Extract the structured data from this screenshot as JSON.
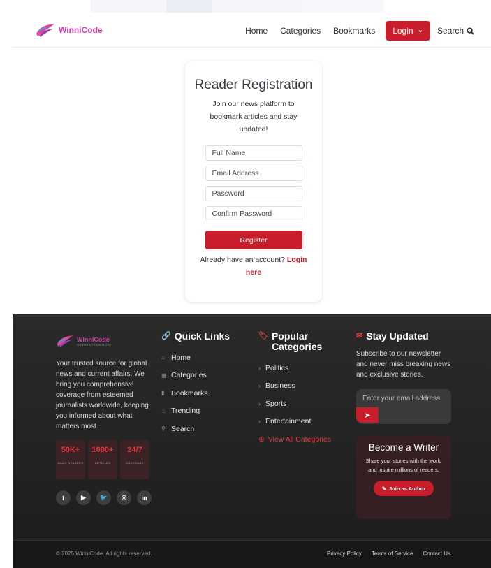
{
  "navbar": {
    "brand": "WinniCode",
    "links": [
      "Home",
      "Categories",
      "Bookmarks"
    ],
    "login_label": "Login",
    "search_label": "Search"
  },
  "registration": {
    "title": "Reader Registration",
    "subtitle": "Join our news platform to bookmark articles and stay updated!",
    "full_name_placeholder": "Full Name",
    "email_placeholder": "Email Address",
    "password_placeholder": "Password",
    "confirm_password_placeholder": "Confirm Password",
    "register_label": "Register",
    "have_account_text": "Already have an account?",
    "login_link": "Login here"
  },
  "footer": {
    "brand": "WinniCode",
    "brand_sub": "GARUDA TEKNOLOGI",
    "about": "Your trusted source for global news and current affairs. We bring you comprehensive coverage from esteemed journalists worldwide, keeping you informed about what matters most.",
    "stats": [
      {
        "value": "50K+",
        "label": "DAILY READERS"
      },
      {
        "value": "1000+",
        "label": "ARTICLES"
      },
      {
        "value": "24/7",
        "label": "COVERAGE"
      }
    ],
    "socials": [
      "f",
      "▶",
      "🐦",
      "◎",
      "in"
    ],
    "quick_links_title": "Quick Links",
    "quick_links": [
      {
        "label": "Home",
        "icon": "⌂"
      },
      {
        "label": "Categories",
        "icon": "▦"
      },
      {
        "label": "Bookmarks",
        "icon": "▮"
      },
      {
        "label": "Trending",
        "icon": "♨"
      },
      {
        "label": "Search",
        "icon": "⚲"
      }
    ],
    "popular_title": "Popular Categories",
    "categories": [
      "Politics",
      "Business",
      "Sports",
      "Entertainment"
    ],
    "view_all": "View All Categories",
    "stay_title": "Stay Updated",
    "stay_text": "Subscribe to our newsletter and never miss breaking news and exclusive stories.",
    "email_placeholder": "Enter your email address",
    "writer_title": "Become a Writer",
    "writer_text": "Share your stories with the world and inspire millions of readers.",
    "writer_button": "Join as Author",
    "copyright": "© 2025 WinniCode. All rights reserved.",
    "bottom_links": [
      "Privacy Policy",
      "Terms of Service",
      "Contact Us"
    ]
  },
  "colors": {
    "accent": "#c81e2c",
    "brand": "#d63fae",
    "footer_bg": "#222222"
  }
}
